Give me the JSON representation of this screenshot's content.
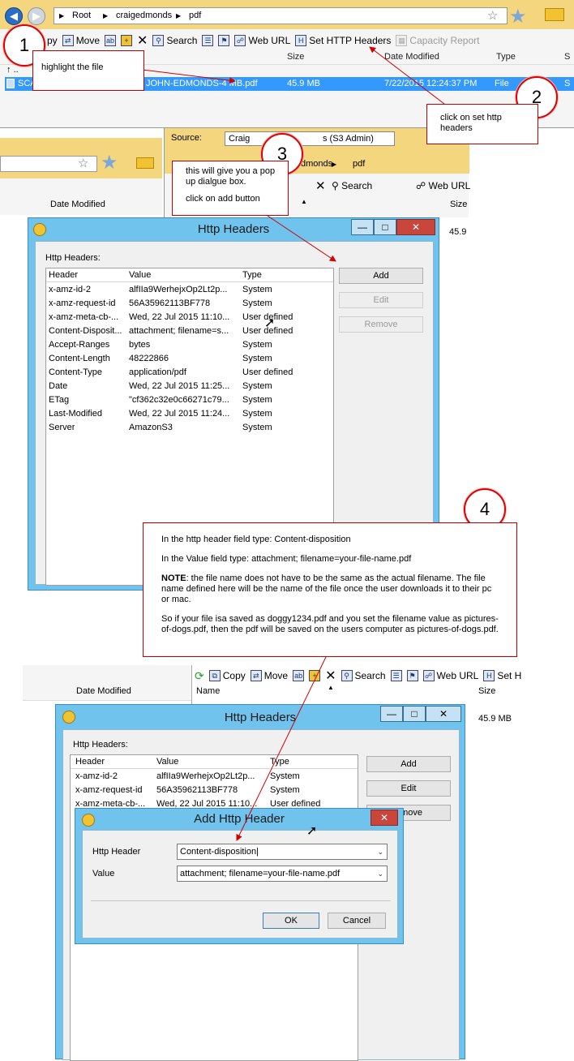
{
  "top_browser": {
    "breadcrumb": [
      "Root",
      "craigedmonds",
      "pdf"
    ],
    "toolbar": [
      "py",
      "Move",
      "Search",
      "Web URL",
      "Set HTTP Headers",
      "Capacity Report"
    ],
    "columns": [
      "Size",
      "Date Modified",
      "Type",
      "S"
    ],
    "up_row": "..",
    "selected_file": {
      "name_start": "SCA",
      "name_end": "JOHN-EDMONDS-4 MB.pdf",
      "size": "45.9 MB",
      "date": "7/22/2015 12:24:37 PM",
      "type": "File",
      "extra": "S"
    }
  },
  "callouts": {
    "c1": {
      "number": "1",
      "text": "highlight the file"
    },
    "c2": {
      "number": "2",
      "text": "click on set http headers"
    },
    "c3": {
      "number": "3",
      "line1": "this will give you a pop up dialgue box.",
      "line2": "click on add button"
    },
    "c4": {
      "number": "4",
      "p1": "In the http header field type:  Content-disposition",
      "p2": "In the Value field type: attachment; filename=your-file-name.pdf",
      "p3_bold": "NOTE",
      "p3": ": the file name does not have to be the same as the actual filename. The file name defined here will be the name of the file once the user downloads it to their pc or mac.",
      "p4": "So if your file isa saved as doggy1234.pdf and you set the filename value as pictures-of-dogs.pdf, then the pdf will be saved on the users computer as pictures-of-dogs.pdf."
    }
  },
  "mid_browser": {
    "source_label": "Source:",
    "source_value": "Craig",
    "source_value_end": "s (S3 Admin)",
    "breadcrumb_frag": "dmonds",
    "breadcrumb_last": "pdf",
    "left_col": "Date Modified",
    "toolbar": [
      "Search",
      "Web URL"
    ],
    "right_col": "Size",
    "size_val": "45.9"
  },
  "dialog1": {
    "title": "Http Headers",
    "group_label": "Http Headers:",
    "columns": [
      "Header",
      "Value",
      "Type"
    ],
    "rows": [
      [
        "x-amz-id-2",
        "alfIIa9WerhejxOp2Lt2p...",
        "System"
      ],
      [
        "x-amz-request-id",
        "56A35962113BF778",
        "System"
      ],
      [
        "x-amz-meta-cb-...",
        "Wed, 22 Jul 2015 11:10...",
        "User defined"
      ],
      [
        "Content-Disposit...",
        "attachment; filename=s...",
        "User defined"
      ],
      [
        "Accept-Ranges",
        "bytes",
        "System"
      ],
      [
        "Content-Length",
        "48222866",
        "System"
      ],
      [
        "Content-Type",
        "application/pdf",
        "User defined"
      ],
      [
        "Date",
        "Wed, 22 Jul 2015 11:25...",
        "System"
      ],
      [
        "ETag",
        "\"cf362c32e0c66271c79...",
        "System"
      ],
      [
        "Last-Modified",
        "Wed, 22 Jul 2015 11:24...",
        "System"
      ],
      [
        "Server",
        "AmazonS3",
        "System"
      ]
    ],
    "buttons": {
      "add": "Add",
      "edit": "Edit",
      "remove": "Remove"
    }
  },
  "lower_browser": {
    "toolbar": [
      "Copy",
      "Move",
      "Search",
      "Web URL",
      "Set H"
    ],
    "left_col": "Date Modified",
    "name_col": "Name",
    "size_col": "Size",
    "size_val": "45.9 MB"
  },
  "dialog2": {
    "title": "Http Headers",
    "group_label": "Http Headers:",
    "columns": [
      "Header",
      "Value",
      "Type"
    ],
    "rows": [
      [
        "x-amz-id-2",
        "alfIIa9WerhejxOp2Lt2p...",
        "System"
      ],
      [
        "x-amz-request-id",
        "56A35962113BF778",
        "System"
      ],
      [
        "x-amz-meta-cb-...",
        "Wed, 22 Jul 2015 11:10...",
        "User defined"
      ]
    ],
    "buttons": {
      "add": "Add",
      "edit": "Edit",
      "remove_frag": "move"
    }
  },
  "add_dialog": {
    "title": "Add Http Header",
    "header_label": "Http Header",
    "header_value": "Content-disposition",
    "value_label": "Value",
    "value_value": "attachment; filename=your-file-name.pdf",
    "ok": "OK",
    "cancel": "Cancel"
  },
  "colors": {
    "accent": "#3399ff",
    "window": "#6fc3ec",
    "callout": "#c00000"
  }
}
